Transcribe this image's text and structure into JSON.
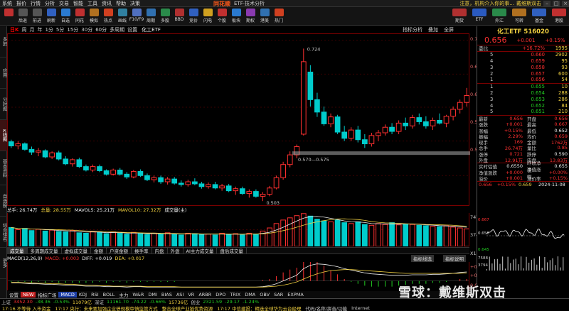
{
  "menu": [
    "系统",
    "报价",
    "行情",
    "分析",
    "交易",
    "智能",
    "工具",
    "资讯",
    "帮助",
    "决策"
  ],
  "app": {
    "logo": "同花顺",
    "window_title": "ETF·技术分析",
    "notice": "注意，机构介入你的事...",
    "account": "戴维斯双击"
  },
  "toolbar_left": [
    {
      "label": "",
      "icon": "home-icon",
      "color": "#c03030"
    },
    {
      "label": "后退",
      "icon": "back-icon",
      "color": "#555"
    },
    {
      "label": "前进",
      "icon": "forward-icon",
      "color": "#555"
    },
    {
      "label": "刷新",
      "icon": "refresh-icon",
      "color": "#3060c0"
    },
    {
      "label": "自选",
      "icon": "star-icon",
      "color": "#2a7ad0"
    },
    {
      "label": "同花",
      "icon": "flower-icon",
      "color": "#c03030"
    },
    {
      "label": "模拟",
      "icon": "chart-icon",
      "color": "#b07020"
    },
    {
      "label": "热点",
      "icon": "fire-icon",
      "color": "#d04020"
    },
    {
      "label": "画线",
      "icon": "pen-icon",
      "color": "#3080a0"
    },
    {
      "label": "F10/F9",
      "icon": "info-icon",
      "color": "#5070c0"
    },
    {
      "label": "周期",
      "icon": "clock-icon",
      "color": "#3070b0"
    },
    {
      "label": "多股",
      "icon": "grid-icon",
      "color": "#2a8a4a"
    },
    {
      "label": "BBD",
      "icon": "bbd-icon",
      "color": "#b03030"
    },
    {
      "label": "竞价",
      "icon": "bid-icon",
      "color": "#3060c0"
    },
    {
      "label": "闪电",
      "icon": "lightning-icon",
      "color": "#d0a020"
    },
    {
      "label": "个股",
      "icon": "stock-icon",
      "color": "#c03030"
    },
    {
      "label": "板块",
      "icon": "sector-icon",
      "color": "#2a7ad0"
    },
    {
      "label": "期权",
      "icon": "option-icon",
      "color": "#8a3ab0"
    },
    {
      "label": "港美",
      "icon": "globe-icon",
      "color": "#3070b0"
    },
    {
      "label": "热门",
      "icon": "hot-icon",
      "color": "#d04020"
    }
  ],
  "toolbar_right": [
    {
      "label": "期货",
      "icon": "futures-icon",
      "color": "#b03030"
    },
    {
      "label": "ETF",
      "icon": "etf-icon",
      "color": "#2a5ac0"
    },
    {
      "label": "外汇",
      "icon": "fx-icon",
      "color": "#2a8a4a"
    },
    {
      "label": "可转",
      "icon": "bond-icon",
      "color": "#b07020"
    },
    {
      "label": "基金",
      "icon": "fund-icon",
      "color": "#3060c0"
    },
    {
      "label": "港股",
      "icon": "hk-icon",
      "color": "#c03030"
    }
  ],
  "left_tabs": [
    "多屏",
    "应用",
    "分时图",
    "K线图",
    "基本资料",
    "自选股",
    "综合排名",
    "更多"
  ],
  "chart_info": {
    "items": [
      "日K",
      "周",
      "月",
      "年",
      "1分",
      "5分",
      "15分",
      "30分",
      "60分",
      "多周期",
      "设置"
    ],
    "name": "化工ETF",
    "right": [
      "指标分析",
      "叠加",
      "全屏"
    ]
  },
  "price_axis": [
    "0.736",
    "0.687",
    "0.639",
    "0.590",
    "0.540"
  ],
  "annotations": {
    "high": "0.724",
    "low": "0.503",
    "range": "0.570—0.575"
  },
  "volume_bar": {
    "total": "总手: 26.74万",
    "vol": "总量: 28.55万",
    "ma5": "MAVOL5: 25.21万",
    "ma10": "MAVOL10: 27.32万",
    "label": "成交量(主)"
  },
  "volume_axis": [
    "747",
    "374",
    "X1000"
  ],
  "volume_tabs": [
    "成交量",
    "多周期成交量",
    "虚拟成交量",
    "金额",
    "户资金额",
    "换手率",
    "内盘",
    "外盘",
    "AI主力成交量",
    "盘后成交量"
  ],
  "macd_bar": {
    "label": "MACD(12,26,9)",
    "macd": "MACD: +0.003",
    "diff": "DIFF: +0.019",
    "dea": "DEA: +0.017",
    "btn1": "指标线选",
    "btn2": "指标说明"
  },
  "macd_axis": [
    "+0.036",
    "+0.026",
    "0.000"
  ],
  "indicator_tabs": [
    "设置",
    "NEW",
    "指标广场",
    "MACD",
    "KDJ",
    "RSI",
    "BOLL",
    "主力",
    "W&R",
    "DMI",
    "BIAS",
    "ASI",
    "VR",
    "ARBR",
    "DPO",
    "TRIX",
    "DMA",
    "OBV",
    "SAR",
    "EXPMA"
  ],
  "sub_tabs": [
    "个股新闻",
    "论坛"
  ],
  "quote": {
    "title": "化工ETF 516020",
    "price": "0.656",
    "change": "+0.001",
    "pct": "+0.15%",
    "weibi": "委比",
    "weibi_pct": "+16.72%",
    "weibi_val": "1995",
    "sell": [
      {
        "n": "5",
        "p": "0.660",
        "v": "2902"
      },
      {
        "n": "4",
        "p": "0.659",
        "v": "95"
      },
      {
        "n": "3",
        "p": "0.658",
        "v": "93"
      },
      {
        "n": "2",
        "p": "0.657",
        "v": "600"
      },
      {
        "n": "1",
        "p": "0.656",
        "v": "54"
      }
    ],
    "buy": [
      {
        "n": "1",
        "p": "0.655",
        "v": "10"
      },
      {
        "n": "2",
        "p": "0.654",
        "v": "288"
      },
      {
        "n": "3",
        "p": "0.653",
        "v": "286"
      },
      {
        "n": "4",
        "p": "0.652",
        "v": "84"
      },
      {
        "n": "5",
        "p": "0.651",
        "v": "210"
      }
    ],
    "stats": [
      {
        "k": "最新",
        "v": "0.656",
        "k2": "开盘",
        "v2": "0.656"
      },
      {
        "k": "涨跌",
        "v": "+0.001",
        "k2": "最高",
        "v2": "0.667"
      },
      {
        "k": "涨幅",
        "v": "+0.15%",
        "k2": "最低",
        "v2": "0.652"
      },
      {
        "k": "振幅",
        "v": "2.29%",
        "k2": "均价",
        "v2": "0.659"
      },
      {
        "k": "现手",
        "v": "169",
        "k2": "金额",
        "v2": "1762万"
      },
      {
        "k": "总手",
        "v": "26.74万",
        "k2": "量比",
        "v2": "0.85"
      },
      {
        "k": "涨停",
        "v": "0.721",
        "k2": "跌停",
        "v2": "0.590"
      },
      {
        "k": "外盘",
        "v": "12.91万",
        "k2": "内盘",
        "v2": "13.83万"
      }
    ],
    "nav": [
      {
        "k": "实时估值",
        "v": "0.6550",
        "k2": "昨收净值",
        "v2": "0.655"
      },
      {
        "k": "净值涨跌",
        "v": "+0.000",
        "k2": "净值涨幅",
        "v2": "+0.00%"
      },
      {
        "k": "溢价",
        "v": "+0.001",
        "k2": "溢价率",
        "v2": "+0.15%"
      }
    ],
    "mini_head": [
      "0.656",
      "+0.15%",
      "0.659",
      "2024-11-08"
    ],
    "mini_axis": [
      "0.667",
      "0.656",
      "0.645",
      "7588",
      "3794"
    ]
  },
  "status": [
    {
      "t": "上证",
      "c": "#ccc"
    },
    {
      "t": "3452.30",
      "c": "#ff3030"
    },
    {
      "t": "-38.36",
      "c": "#22cc22"
    },
    {
      "t": "-0.53%",
      "c": "#22cc22"
    },
    {
      "t": "11079亿",
      "c": "#f0d040"
    },
    {
      "t": "深证",
      "c": "#ccc"
    },
    {
      "t": "11161.70",
      "c": "#22cc22"
    },
    {
      "t": "-74.22",
      "c": "#22cc22"
    },
    {
      "t": "-0.66%",
      "c": "#22cc22"
    },
    {
      "t": "15736亿",
      "c": "#f0d040"
    },
    {
      "t": "创业",
      "c": "#ccc"
    },
    {
      "t": "2321.59",
      "c": "#22cc22"
    },
    {
      "t": "-29.17",
      "c": "#22cc22"
    },
    {
      "t": "-1.24%",
      "c": "#22cc22"
    }
  ],
  "ticker": [
    {
      "t": "17:16 不等待 入市资金",
      "c": "#f0d040"
    },
    {
      "t": "17:17 央行：未来要加强企业债规模审慎监管方式",
      "c": "#f0d040"
    },
    {
      "t": "整合全球产业链优势资源",
      "c": "#f0d040"
    },
    {
      "t": "17:17 中信建投：精选全球华为云台经理",
      "c": "#f0d040"
    },
    {
      "t": "代码/名称/拼音/功能",
      "c": "#ccc"
    },
    {
      "t": "Internet",
      "c": "#ccc"
    }
  ],
  "watermark": "雪球：戴维斯双击",
  "chart_data": {
    "type": "candlestick",
    "ylim": [
      0.5,
      0.74
    ],
    "ohlc": [
      [
        0.589,
        0.592,
        0.58,
        0.583
      ],
      [
        0.583,
        0.59,
        0.578,
        0.586
      ],
      [
        0.586,
        0.588,
        0.576,
        0.578
      ],
      [
        0.578,
        0.582,
        0.57,
        0.574
      ],
      [
        0.574,
        0.58,
        0.568,
        0.576
      ],
      [
        0.576,
        0.578,
        0.565,
        0.567
      ],
      [
        0.567,
        0.575,
        0.564,
        0.573
      ],
      [
        0.573,
        0.576,
        0.562,
        0.564
      ],
      [
        0.564,
        0.568,
        0.555,
        0.557
      ],
      [
        0.557,
        0.565,
        0.553,
        0.563
      ],
      [
        0.563,
        0.566,
        0.551,
        0.553
      ],
      [
        0.553,
        0.556,
        0.546,
        0.548
      ],
      [
        0.548,
        0.556,
        0.545,
        0.553
      ],
      [
        0.553,
        0.556,
        0.545,
        0.547
      ],
      [
        0.547,
        0.549,
        0.54,
        0.542
      ],
      [
        0.542,
        0.55,
        0.54,
        0.548
      ],
      [
        0.548,
        0.551,
        0.54,
        0.542
      ],
      [
        0.542,
        0.545,
        0.535,
        0.538
      ],
      [
        0.538,
        0.548,
        0.536,
        0.546
      ],
      [
        0.546,
        0.549,
        0.538,
        0.54
      ],
      [
        0.54,
        0.543,
        0.532,
        0.534
      ],
      [
        0.534,
        0.54,
        0.53,
        0.537
      ],
      [
        0.537,
        0.54,
        0.528,
        0.531
      ],
      [
        0.531,
        0.538,
        0.527,
        0.535
      ],
      [
        0.535,
        0.538,
        0.527,
        0.529
      ],
      [
        0.529,
        0.533,
        0.524,
        0.527
      ],
      [
        0.527,
        0.534,
        0.524,
        0.531
      ],
      [
        0.531,
        0.536,
        0.526,
        0.528
      ],
      [
        0.528,
        0.531,
        0.521,
        0.524
      ],
      [
        0.524,
        0.53,
        0.521,
        0.527
      ],
      [
        0.527,
        0.531,
        0.52,
        0.522
      ],
      [
        0.522,
        0.528,
        0.518,
        0.525
      ],
      [
        0.525,
        0.528,
        0.516,
        0.518
      ],
      [
        0.518,
        0.524,
        0.512,
        0.521
      ],
      [
        0.521,
        0.524,
        0.512,
        0.514
      ],
      [
        0.514,
        0.52,
        0.508,
        0.517
      ],
      [
        0.517,
        0.52,
        0.508,
        0.51
      ],
      [
        0.51,
        0.516,
        0.503,
        0.513
      ],
      [
        0.513,
        0.525,
        0.51,
        0.522
      ],
      [
        0.522,
        0.54,
        0.52,
        0.537
      ],
      [
        0.537,
        0.56,
        0.534,
        0.556
      ],
      [
        0.556,
        0.575,
        0.552,
        0.57
      ],
      [
        0.57,
        0.585,
        0.565,
        0.582
      ],
      [
        0.6,
        0.724,
        0.598,
        0.705
      ],
      [
        0.69,
        0.7,
        0.64,
        0.65
      ],
      [
        0.65,
        0.66,
        0.625,
        0.632
      ],
      [
        0.632,
        0.64,
        0.612,
        0.615
      ],
      [
        0.615,
        0.63,
        0.61,
        0.625
      ],
      [
        0.625,
        0.628,
        0.6,
        0.603
      ],
      [
        0.603,
        0.612,
        0.59,
        0.594
      ],
      [
        0.594,
        0.61,
        0.59,
        0.606
      ],
      [
        0.606,
        0.612,
        0.588,
        0.592
      ],
      [
        0.592,
        0.6,
        0.58,
        0.586
      ],
      [
        0.586,
        0.602,
        0.582,
        0.598
      ],
      [
        0.598,
        0.606,
        0.59,
        0.602
      ],
      [
        0.602,
        0.614,
        0.598,
        0.61
      ],
      [
        0.61,
        0.616,
        0.6,
        0.604
      ],
      [
        0.604,
        0.62,
        0.6,
        0.616
      ],
      [
        0.616,
        0.624,
        0.606,
        0.612
      ],
      [
        0.612,
        0.628,
        0.608,
        0.624
      ],
      [
        0.624,
        0.63,
        0.614,
        0.618
      ],
      [
        0.618,
        0.626,
        0.608,
        0.612
      ],
      [
        0.612,
        0.624,
        0.606,
        0.62
      ],
      [
        0.62,
        0.63,
        0.614,
        0.616
      ],
      [
        0.616,
        0.628,
        0.61,
        0.626
      ],
      [
        0.626,
        0.64,
        0.62,
        0.636
      ],
      [
        0.636,
        0.65,
        0.63,
        0.646
      ],
      [
        0.646,
        0.667,
        0.64,
        0.656
      ]
    ],
    "volume": [
      430,
      380,
      410,
      360,
      390,
      350,
      370,
      340,
      330,
      360,
      310,
      300,
      340,
      320,
      290,
      330,
      300,
      280,
      320,
      290,
      270,
      300,
      280,
      310,
      270,
      260,
      300,
      290,
      270,
      280,
      260,
      300,
      270,
      290,
      260,
      300,
      280,
      350,
      420,
      520,
      600,
      650,
      700,
      747,
      690,
      620,
      580,
      560,
      600,
      540,
      520,
      560,
      500,
      480,
      520,
      500,
      540,
      490,
      510,
      500,
      480,
      470,
      460,
      450,
      470,
      440,
      420,
      400
    ],
    "macd_dif": [
      -0.004,
      -0.004,
      -0.005,
      -0.006,
      -0.006,
      -0.007,
      -0.007,
      -0.008,
      -0.009,
      -0.009,
      -0.01,
      -0.011,
      -0.011,
      -0.011,
      -0.012,
      -0.012,
      -0.012,
      -0.013,
      -0.012,
      -0.012,
      -0.013,
      -0.013,
      -0.013,
      -0.013,
      -0.013,
      -0.013,
      -0.013,
      -0.013,
      -0.013,
      -0.013,
      -0.013,
      -0.013,
      -0.013,
      -0.013,
      -0.013,
      -0.013,
      -0.013,
      -0.012,
      -0.01,
      -0.006,
      0.0,
      0.006,
      0.012,
      0.026,
      0.033,
      0.036,
      0.035,
      0.033,
      0.03,
      0.026,
      0.023,
      0.02,
      0.017,
      0.015,
      0.014,
      0.013,
      0.012,
      0.012,
      0.012,
      0.013,
      0.013,
      0.013,
      0.014,
      0.014,
      0.015,
      0.016,
      0.018,
      0.019
    ],
    "macd_dea": [
      -0.003,
      -0.003,
      -0.004,
      -0.004,
      -0.005,
      -0.005,
      -0.006,
      -0.006,
      -0.007,
      -0.007,
      -0.008,
      -0.009,
      -0.009,
      -0.01,
      -0.01,
      -0.011,
      -0.011,
      -0.011,
      -0.011,
      -0.011,
      -0.012,
      -0.012,
      -0.012,
      -0.012,
      -0.012,
      -0.013,
      -0.013,
      -0.013,
      -0.013,
      -0.013,
      -0.013,
      -0.013,
      -0.013,
      -0.013,
      -0.013,
      -0.013,
      -0.013,
      -0.013,
      -0.012,
      -0.011,
      -0.009,
      -0.006,
      -0.002,
      0.004,
      0.01,
      0.015,
      0.019,
      0.022,
      0.023,
      0.024,
      0.024,
      0.023,
      0.022,
      0.021,
      0.02,
      0.019,
      0.018,
      0.017,
      0.016,
      0.016,
      0.016,
      0.016,
      0.016,
      0.016,
      0.016,
      0.016,
      0.016,
      0.017
    ]
  }
}
